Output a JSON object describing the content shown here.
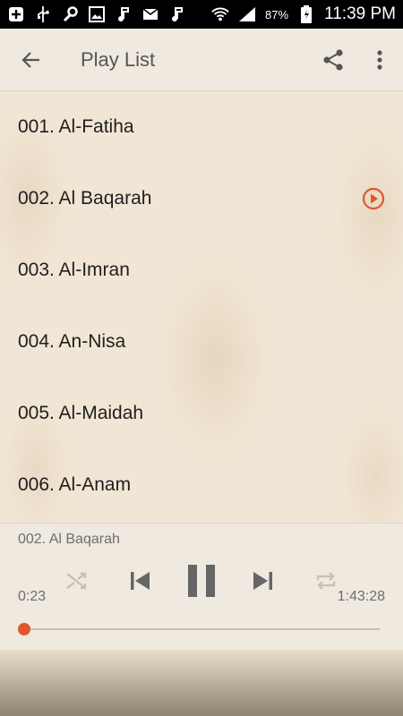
{
  "status_bar": {
    "battery_percent": "87%",
    "time": "11:39 PM",
    "icons_left": [
      "plus-square-icon",
      "usb-icon",
      "wrench-icon",
      "image-icon",
      "music-note-icon",
      "mail-icon",
      "music-note-icon"
    ],
    "icons_right": [
      "wifi-icon",
      "signal-icon",
      "battery-icon"
    ]
  },
  "toolbar": {
    "title": "Play List",
    "icons": [
      "back-arrow-icon",
      "share-icon",
      "more-vert-icon"
    ]
  },
  "playlist": {
    "items": [
      {
        "label": "001. Al-Fatiha",
        "playing": false
      },
      {
        "label": "002. Al Baqarah",
        "playing": true
      },
      {
        "label": "003. Al-Imran",
        "playing": false
      },
      {
        "label": "004. An-Nisa",
        "playing": false
      },
      {
        "label": "005. Al-Maidah",
        "playing": false
      },
      {
        "label": "006. Al-Anam",
        "playing": false
      }
    ]
  },
  "player": {
    "now_playing": "002. Al Baqarah",
    "elapsed": "0:23",
    "duration": "1:43:28",
    "progress_fraction": 0.0037,
    "accent_color": "#e0572a",
    "controls": [
      "shuffle-icon",
      "previous-icon",
      "pause-icon",
      "next-icon",
      "repeat-icon"
    ]
  }
}
